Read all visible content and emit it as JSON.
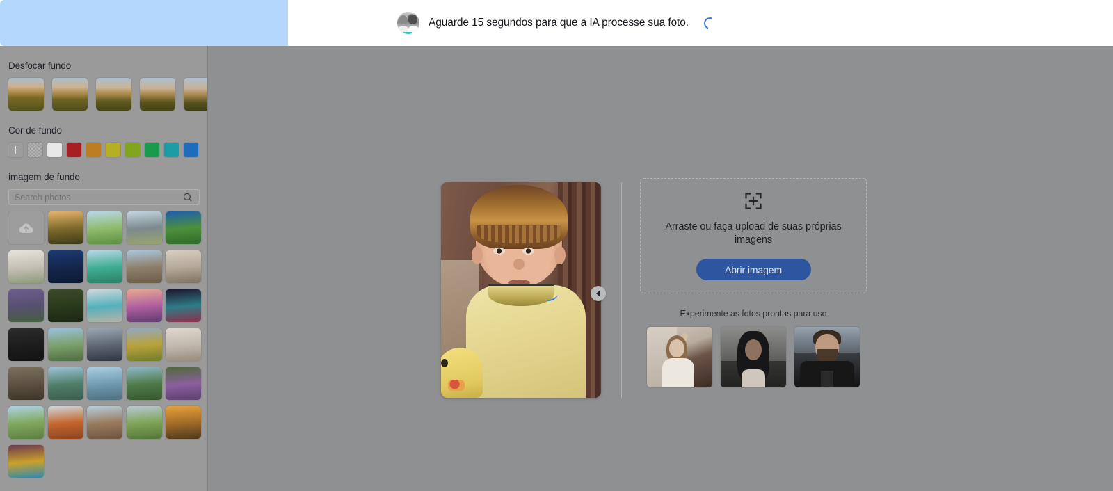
{
  "topbar": {
    "message": "Aguarde 15 segundos para que a IA processe sua foto.",
    "avatar_icon": "user-avatar",
    "spinner_icon": "loading-spinner",
    "progress_percent": 26,
    "progress_color": "#b4d7fd"
  },
  "sidebar": {
    "blur_section": {
      "title": "Desfocar fundo",
      "options": [
        {
          "name": "blur-level-0"
        },
        {
          "name": "blur-level-1"
        },
        {
          "name": "blur-level-2"
        },
        {
          "name": "blur-level-3"
        },
        {
          "name": "blur-level-4"
        }
      ]
    },
    "color_section": {
      "title": "Cor de fundo",
      "add_icon": "plus-icon",
      "swatches": [
        {
          "name": "custom-color-picker",
          "color": "#9d9d9e"
        },
        {
          "name": "transparent",
          "color": "transparent"
        },
        {
          "name": "white",
          "color": "#e7e7e7"
        },
        {
          "name": "red",
          "color": "#a71f22"
        },
        {
          "name": "orange",
          "color": "#bd7d22"
        },
        {
          "name": "yellow",
          "color": "#b6ae25"
        },
        {
          "name": "lime",
          "color": "#81a51c"
        },
        {
          "name": "green",
          "color": "#199a4d"
        },
        {
          "name": "teal",
          "color": "#1f9ba6"
        },
        {
          "name": "blue",
          "color": "#1d6cbe"
        }
      ]
    },
    "image_section": {
      "title": "imagem de fundo",
      "search_placeholder": "Search photos",
      "search_value": "",
      "search_icon": "search-icon",
      "upload_icon": "cloud-upload-icon",
      "thumbnails": [
        {
          "name": "upload-tile",
          "kind": "upload"
        },
        {
          "name": "photo-balloons-sunset",
          "c1": "#e8b36a",
          "c2": "#7d6a2c",
          "c3": "#3e3a18"
        },
        {
          "name": "photo-lone-tree-field",
          "c1": "#b8d7e8",
          "c2": "#8fbb6c",
          "c3": "#5c8f41"
        },
        {
          "name": "photo-matterhorn",
          "c1": "#c3d4e0",
          "c2": "#7c8a8e",
          "c3": "#9aa46d"
        },
        {
          "name": "photo-alpine-meadow",
          "c1": "#1d5fae",
          "c2": "#4e8f3c",
          "c3": "#2f6b2a"
        },
        {
          "name": "photo-plant-shelf",
          "c1": "#e6e3dc",
          "c2": "#c5c0b4",
          "c3": "#8e9a7c"
        },
        {
          "name": "photo-full-moon",
          "c1": "#1b3a74",
          "c2": "#14264c",
          "c3": "#0c1a34"
        },
        {
          "name": "photo-green-beetle-car",
          "c1": "#b9d6e6",
          "c2": "#3fae93",
          "c3": "#2c7f64"
        },
        {
          "name": "photo-desert-road",
          "c1": "#a9c7dc",
          "c2": "#8e7f6a",
          "c3": "#6a5c48"
        },
        {
          "name": "photo-curtain-window",
          "c1": "#d8cec1",
          "c2": "#b4a898",
          "c3": "#7d7263"
        },
        {
          "name": "photo-purple-mountain-dusk",
          "c1": "#6d5e8e",
          "c2": "#57506f",
          "c3": "#44603f"
        },
        {
          "name": "photo-bench-under-tree",
          "c1": "#3d4a28",
          "c2": "#2a3a1c",
          "c3": "#1b2713"
        },
        {
          "name": "photo-beach-umbrella",
          "c1": "#cfd9db",
          "c2": "#54b1bc",
          "c3": "#b8b2a4"
        },
        {
          "name": "photo-flower-field-sunset",
          "c1": "#e8a98f",
          "c2": "#b05fa0",
          "c3": "#5d3c6e"
        },
        {
          "name": "photo-ferris-wheel-neon",
          "c1": "#1d1530",
          "c2": "#2f7c86",
          "c3": "#8e2f4a"
        },
        {
          "name": "photo-chalkboard-equations",
          "c1": "#2b2b2b",
          "c2": "#1d1d1d",
          "c3": "#121212"
        },
        {
          "name": "photo-park-path-trees",
          "c1": "#9bc0de",
          "c2": "#7ba06a",
          "c3": "#4f6b3f"
        },
        {
          "name": "photo-snow-birch-forest",
          "c1": "#9ba7b3",
          "c2": "#5e6672",
          "c3": "#2f3742"
        },
        {
          "name": "photo-tulip-field",
          "c1": "#93a8c2",
          "c2": "#b9a23a",
          "c3": "#6f7d2c"
        },
        {
          "name": "photo-white-corridor",
          "c1": "#ded8d0",
          "c2": "#c2b9ad",
          "c3": "#968b7c"
        },
        {
          "name": "photo-stone-columns",
          "c1": "#7d6f5c",
          "c2": "#5c5142",
          "c3": "#3c3427"
        },
        {
          "name": "photo-coastal-cliff",
          "c1": "#9dc3d8",
          "c2": "#4f7f6a",
          "c3": "#3b5c4c"
        },
        {
          "name": "photo-wooden-pier-lake",
          "c1": "#a9cfe2",
          "c2": "#6f9ab0",
          "c3": "#4d6f7f"
        },
        {
          "name": "photo-green-valley",
          "c1": "#8fb7c9",
          "c2": "#4f7a48",
          "c3": "#37582f"
        },
        {
          "name": "photo-purple-flower-path",
          "c1": "#4f6b3a",
          "c2": "#8a5f9e",
          "c3": "#5c3f6e"
        },
        {
          "name": "photo-grass-walkway",
          "c1": "#aed2e6",
          "c2": "#7fa85c",
          "c3": "#5c7f42"
        },
        {
          "name": "photo-orange-village",
          "c1": "#cfd8dd",
          "c2": "#c4652c",
          "c3": "#8c4620"
        },
        {
          "name": "photo-leaning-tower-pisa",
          "c1": "#b6cede",
          "c2": "#9a7a5c",
          "c3": "#6e5440"
        },
        {
          "name": "photo-green-pasture",
          "c1": "#b9c9d4",
          "c2": "#7ea356",
          "c3": "#55763a"
        },
        {
          "name": "photo-railway-sunset",
          "c1": "#e8a23c",
          "c2": "#a06a28",
          "c3": "#4c3a1c"
        },
        {
          "name": "photo-colorful-ferris-wheel",
          "c1": "#6b3a4e",
          "c2": "#c9a02c",
          "c3": "#2f8ab0"
        }
      ]
    }
  },
  "main": {
    "preview": {
      "name": "subject-photo-preview",
      "alt": "vintage portrait of a young boy in a yellow shirt"
    },
    "collapse_icon": "collapse-left-arrow-icon",
    "dropzone": {
      "icon": "crop-plus-icon",
      "text": "Arraste ou faça upload de suas próprias imagens",
      "button_label": "Abrir imagem",
      "button_color": "#2d55a0"
    },
    "ready_photos": {
      "label": "Experimente as fotos prontas para uso",
      "items": [
        {
          "name": "ready-photo-woman-white-top"
        },
        {
          "name": "ready-photo-long-hair-person"
        },
        {
          "name": "ready-photo-man-leather-jacket"
        }
      ]
    }
  }
}
